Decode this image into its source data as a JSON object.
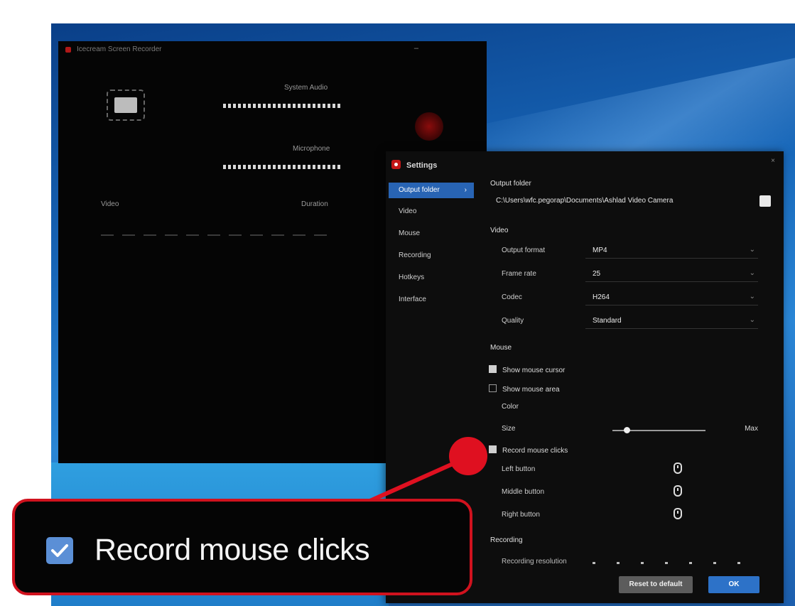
{
  "main_window": {
    "title": "Icecream Screen Recorder",
    "minimize_glyph": "–",
    "system_audio_label": "System Audio",
    "microphone_label": "Microphone",
    "video_col_label": "Video",
    "duration_col_label": "Duration"
  },
  "settings": {
    "title": "Settings",
    "close_glyph": "×",
    "nav": [
      {
        "label": "Output folder",
        "active": true
      },
      {
        "label": "Video",
        "active": false
      },
      {
        "label": "Mouse",
        "active": false
      },
      {
        "label": "Recording",
        "active": false
      },
      {
        "label": "Hotkeys",
        "active": false
      },
      {
        "label": "Interface",
        "active": false
      }
    ],
    "output_folder": {
      "title": "Output folder",
      "path": "C:\\Users\\wfc.pegorap\\Documents\\Ashlad Video Camera"
    },
    "video": {
      "title": "Video",
      "fields": [
        {
          "label": "Output format",
          "value": "MP4"
        },
        {
          "label": "Frame rate",
          "value": "25"
        },
        {
          "label": "Codec",
          "value": "H264"
        },
        {
          "label": "Quality",
          "value": "Standard"
        }
      ]
    },
    "mouse": {
      "title": "Mouse",
      "show_cursor": {
        "label": "Show mouse cursor",
        "checked": true
      },
      "show_area": {
        "label": "Show mouse area",
        "checked": false
      },
      "color_label": "Color",
      "size_label": "Size",
      "size_max_label": "Max",
      "size_level": 0.15,
      "record_clicks": {
        "label": "Record mouse clicks",
        "checked": true
      },
      "buttons": [
        {
          "label": "Left button",
          "icon": "mouse-icon"
        },
        {
          "label": "Middle button",
          "icon": "mouse-icon"
        },
        {
          "label": "Right button",
          "icon": "mouse-icon"
        }
      ]
    },
    "recording": {
      "title": "Recording",
      "resolution_label": "Recording resolution"
    },
    "buttons": {
      "reset": "Reset to default",
      "ok": "OK"
    }
  },
  "callout": {
    "label": "Record mouse clicks",
    "checked": true,
    "accent": "#d0121e",
    "checkbox_color": "#5b8fd6"
  }
}
